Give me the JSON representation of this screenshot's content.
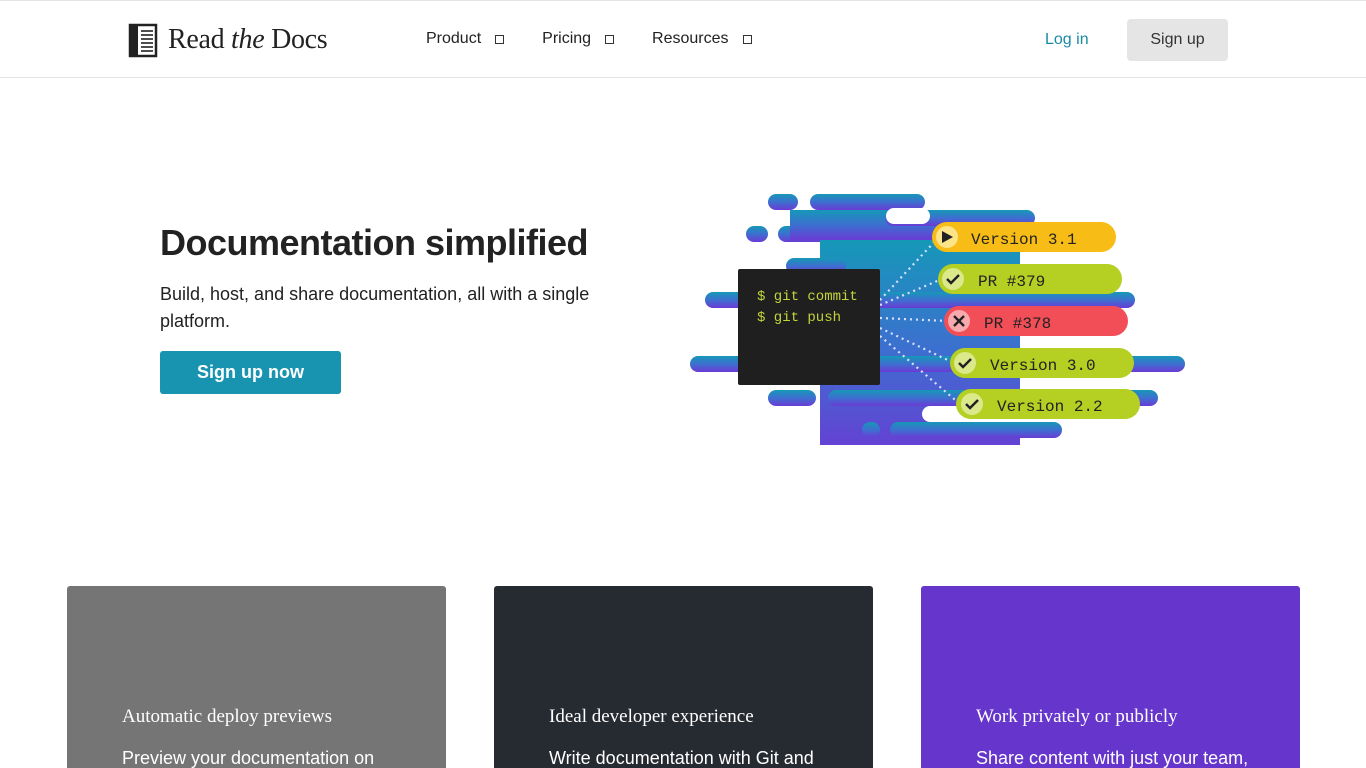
{
  "brand": {
    "name_part1": "Read",
    "name_part2": "the",
    "name_part3": "Docs"
  },
  "nav": {
    "items": [
      {
        "label": "Product"
      },
      {
        "label": "Pricing"
      },
      {
        "label": "Resources"
      }
    ],
    "login_label": "Log in",
    "signup_label": "Sign up"
  },
  "hero": {
    "title": "Documentation simplified",
    "subtitle": "Build, host, and share documentation, all with a single platform.",
    "cta_label": "Sign up now"
  },
  "illustration": {
    "terminal_lines": [
      "$ git commit",
      "$ git push"
    ],
    "builds": [
      {
        "label": "Version 3.1",
        "status": "building"
      },
      {
        "label": "PR #379",
        "status": "passed"
      },
      {
        "label": "PR #378",
        "status": "failed"
      },
      {
        "label": "Version 3.0",
        "status": "passed"
      },
      {
        "label": "Version 2.2",
        "status": "passed"
      }
    ]
  },
  "cards": [
    {
      "title": "Automatic deploy previews",
      "desc": "Preview your documentation on",
      "color": "#757575"
    },
    {
      "title": "Ideal developer experience",
      "desc": "Write documentation with Git and",
      "color": "#262a31"
    },
    {
      "title": "Work privately or publicly",
      "desc": "Share content with just your team,",
      "color": "#6535cc"
    }
  ],
  "colors": {
    "accent": "#1893b0",
    "link": "#1a8ba4",
    "build_building": "#f7bd16",
    "build_passed": "#b5cf22",
    "build_failed": "#f24e57"
  }
}
